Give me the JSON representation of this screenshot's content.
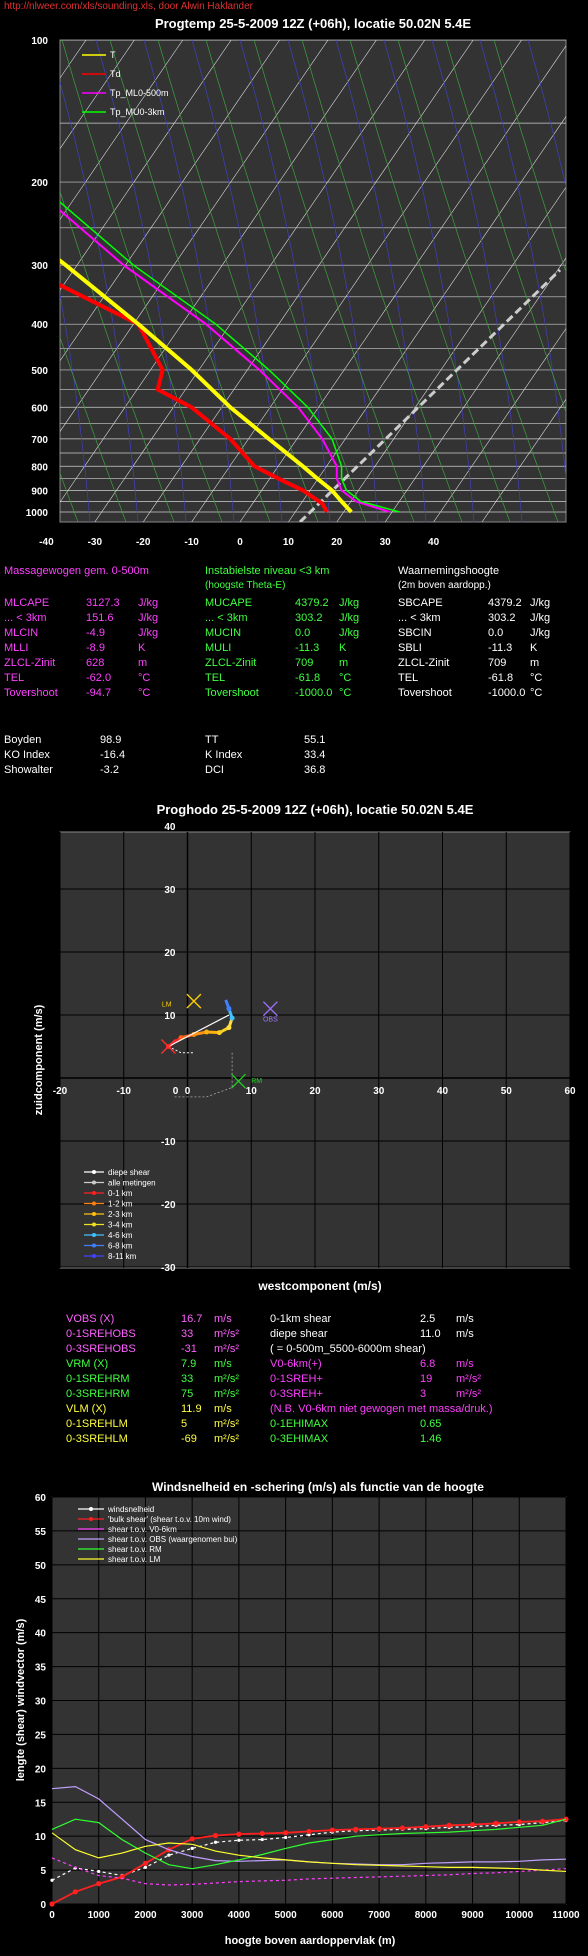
{
  "source_link": "http://nlweer.com/xls/sounding.xls, door Alwin Haklander",
  "colors": {
    "temp": "#ffff00",
    "dew": "#ff0000",
    "ml": "#ff00ff",
    "mu": "#00ff00",
    "grid": "#ffffff",
    "bg": "#333333"
  },
  "sounding": {
    "title": "Progtemp 25-5-2009  12Z (+06h),  locatie 50.02N  5.4E",
    "legend": [
      "T",
      "Td",
      "Tp_ML0-500m",
      "Tp_MU0-3km"
    ],
    "y_ticks": [
      "100",
      "200",
      "300",
      "400",
      "500",
      "600",
      "700",
      "800",
      "900",
      "1000"
    ],
    "x_ticks": [
      "-40",
      "-30",
      "-20",
      "-10",
      "0",
      "10",
      "20",
      "30",
      "40"
    ]
  },
  "indices": {
    "col1_header": "Massagewogen gem. 0-500m",
    "col1": [
      [
        "MLCAPE",
        "3127.3",
        "J/kg"
      ],
      [
        "... < 3km",
        "151.6",
        "J/kg"
      ],
      [
        "MLCIN",
        "-4.9",
        "J/kg"
      ],
      [
        "MLLI",
        "-8.9",
        "K"
      ],
      [
        "ZLCL-Zinit",
        "628",
        "m"
      ],
      [
        "TEL",
        "-62.0",
        "°C"
      ],
      [
        "Tovershoot",
        "-94.7",
        "°C"
      ]
    ],
    "col2_header": "Instabielste niveau <3 km",
    "col2_sub": "(hoogste Theta-E)",
    "col2": [
      [
        "MUCAPE",
        "4379.2",
        "J/kg"
      ],
      [
        "... < 3km",
        "303.2",
        "J/kg"
      ],
      [
        "MUCIN",
        "0.0",
        "J/kg"
      ],
      [
        "MULI",
        "-11.3",
        "K"
      ],
      [
        "ZLCL-Zinit",
        "709",
        "m"
      ],
      [
        "TEL",
        "-61.8",
        "°C"
      ],
      [
        "Tovershoot",
        "-1000.0",
        "°C"
      ]
    ],
    "col3_header": "Waarnemingshoogte",
    "col3_sub": "(2m boven aardopp.)",
    "col3": [
      [
        "SBCAPE",
        "4379.2",
        "J/kg"
      ],
      [
        "... < 3km",
        "303.2",
        "J/kg"
      ],
      [
        "SBCIN",
        "0.0",
        "J/kg"
      ],
      [
        "SBLI",
        "-11.3",
        "K"
      ],
      [
        "ZLCL-Zinit",
        "709",
        "m"
      ],
      [
        "TEL",
        "-61.8",
        "°C"
      ],
      [
        "Tovershoot",
        "-1000.0",
        "°C"
      ]
    ],
    "misc": [
      [
        "Boyden",
        "98.9",
        "TT",
        "55.1"
      ],
      [
        "KO Index",
        "-16.4",
        "K Index",
        "33.4"
      ],
      [
        "Showalter",
        "-3.2",
        "DCI",
        "36.8"
      ]
    ]
  },
  "hodograph": {
    "title": "Proghodo 25-5-2009  12Z (+06h),  locatie 50.02N  5.4E",
    "ylabel": "zuidcomponent  (m/s)",
    "xlabel": "westcomponent  (m/s)",
    "x_ticks": [
      "-20",
      "-10",
      "0",
      "10",
      "20",
      "30",
      "40",
      "50",
      "60"
    ],
    "y_ticks": [
      "40",
      "30",
      "20",
      "10",
      "-10",
      "-20",
      "-30"
    ],
    "x_zero": "0",
    "marker_labels": {
      "lm": "LM",
      "obs": "OBS",
      "rm": "RM"
    },
    "legend": [
      "diepe shear",
      "alle metingen",
      "0-1 km",
      "1-2 km",
      "2-3 km",
      "3-4 km",
      "4-6 km",
      "6-8 km",
      "8-11 km"
    ]
  },
  "hodo_params": {
    "left": [
      [
        "VOBS (X)",
        "16.7",
        "m/s",
        "pink"
      ],
      [
        "0-1SREHOBS",
        "33",
        "m²/s²",
        "pink"
      ],
      [
        "0-3SREHOBS",
        "-31",
        "m²/s²",
        "pink"
      ],
      [
        "VRM (X)",
        "7.9",
        "m/s",
        "grn"
      ],
      [
        "0-1SREHRM",
        "33",
        "m²/s²",
        "grn"
      ],
      [
        "0-3SREHRM",
        "75",
        "m²/s²",
        "grn"
      ],
      [
        "VLM (X)",
        "11.9",
        "m/s",
        "yel"
      ],
      [
        "0-1SREHLM",
        "5",
        "m²/s²",
        "yel"
      ],
      [
        "0-3SREHLM",
        "-69",
        "m²/s²",
        "yel"
      ]
    ],
    "right": [
      [
        "0-1km shear",
        "2.5",
        "m/s",
        "wht"
      ],
      [
        "diepe shear",
        "11.0",
        "m/s",
        "wht"
      ],
      [
        "( = 0-500m_5500-6000m shear)",
        "",
        "",
        "wht"
      ],
      [
        "V0-6km(+)",
        "6.8",
        "m/s",
        "mag"
      ],
      [
        "0-1SREH+",
        "19",
        "m²/s²",
        "mag"
      ],
      [
        "0-3SREH+",
        "3",
        "m²/s²",
        "mag"
      ],
      [
        "(N.B. V0-6km niet gewogen met massa/druk.)",
        "",
        "",
        "mag"
      ],
      [
        "0-1EHIMAX",
        "0.65",
        "",
        "grn"
      ],
      [
        "0-3EHIMAX",
        "1.46",
        "",
        "grn"
      ]
    ]
  },
  "chart_data": {
    "type": "line",
    "title": "Windsnelheid en -schering (m/s) als functie van de hoogte",
    "xlabel": "hoogte boven aardoppervlak (m)",
    "ylabel": "lengte (shear) windvector (m/s)",
    "xlim": [
      0,
      11000
    ],
    "ylim": [
      0,
      60
    ],
    "x_ticks": [
      "0",
      "1000",
      "2000",
      "3000",
      "4000",
      "5000",
      "6000",
      "7000",
      "8000",
      "9000",
      "10000",
      "11000"
    ],
    "y_ticks": [
      "0",
      "5",
      "10",
      "15",
      "20",
      "25",
      "30",
      "35",
      "40",
      "45",
      "50",
      "55",
      "60"
    ],
    "x": [
      0,
      500,
      1000,
      1500,
      2000,
      2500,
      3000,
      3500,
      4000,
      4500,
      5000,
      5500,
      6000,
      6500,
      7000,
      7500,
      8000,
      8500,
      9000,
      9500,
      10000,
      10500,
      11000
    ],
    "series": [
      {
        "name": "windsnelheid",
        "color": "#ffffff",
        "values": [
          3.5,
          5.3,
          4.8,
          4.2,
          5.4,
          7.2,
          8.2,
          9.1,
          9.4,
          9.5,
          9.8,
          10.2,
          10.6,
          10.8,
          10.9,
          11.0,
          11.1,
          11.3,
          11.4,
          11.6,
          11.7,
          12.0,
          12.3
        ]
      },
      {
        "name": "'bulk shear' (shear t.o.v. 10m wind)",
        "color": "#ff2020",
        "values": [
          0.0,
          1.8,
          3.0,
          4.0,
          6.0,
          8.0,
          9.6,
          10.1,
          10.3,
          10.4,
          10.5,
          10.7,
          10.9,
          11.0,
          11.1,
          11.2,
          11.4,
          11.6,
          11.7,
          11.9,
          12.1,
          12.2,
          12.5
        ]
      },
      {
        "name": "shear t.o.v. V0-6km",
        "color": "#ff40ff",
        "values": [
          6.8,
          5.4,
          4.2,
          3.8,
          3.0,
          2.8,
          2.9,
          3.1,
          3.3,
          3.4,
          3.5,
          3.7,
          3.8,
          3.9,
          4.0,
          4.1,
          4.2,
          4.3,
          4.5,
          4.6,
          4.8,
          5.0,
          5.2
        ]
      },
      {
        "name": "shear t.o.v. OBS (waargenomen bui)",
        "color": "#c0a0ff",
        "values": [
          17.0,
          17.3,
          15.5,
          12.5,
          9.5,
          8.0,
          7.0,
          6.4,
          6.3,
          6.4,
          6.5,
          6.2,
          6.0,
          5.9,
          5.8,
          5.8,
          6.0,
          6.1,
          6.2,
          6.2,
          6.3,
          6.5,
          6.6
        ]
      },
      {
        "name": "shear t.o.v. RM",
        "color": "#30ff30",
        "values": [
          11.0,
          12.5,
          12.0,
          9.5,
          7.5,
          5.8,
          5.2,
          5.8,
          6.5,
          7.3,
          8.2,
          9.0,
          9.5,
          10.0,
          10.2,
          10.4,
          10.5,
          10.6,
          10.8,
          11.0,
          11.3,
          11.6,
          12.5
        ]
      },
      {
        "name": "shear t.o.v. LM",
        "color": "#ffff30",
        "values": [
          10.5,
          8.0,
          6.8,
          7.5,
          8.5,
          9.0,
          8.8,
          7.8,
          7.2,
          6.8,
          6.5,
          6.2,
          6.0,
          5.8,
          5.7,
          5.6,
          5.5,
          5.4,
          5.4,
          5.3,
          5.2,
          5.0,
          4.8
        ]
      }
    ]
  }
}
